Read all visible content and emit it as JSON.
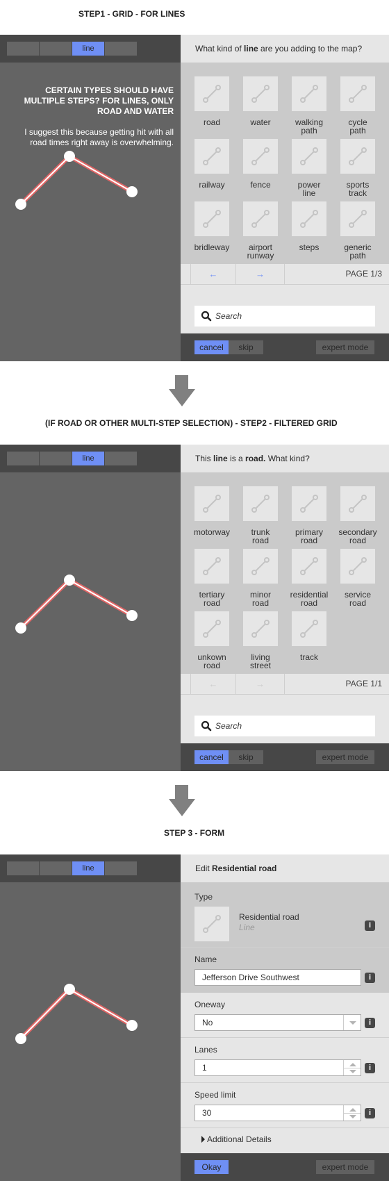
{
  "steps": [
    {
      "title": "STEP1 - GRID - FOR LINES",
      "mode_tabs": [
        "",
        "",
        "line",
        ""
      ],
      "active_mode": "line",
      "note": {
        "title": "CERTAIN TYPES SHOULD HAVE MULTIPLE STEPS? FOR LINES, ONLY ROAD AND WATER",
        "body": "I suggest this because getting hit with all road times right away is overwhelming."
      },
      "header": {
        "pre": "What kind of ",
        "bold": "line",
        "post": " are you adding to the map?"
      },
      "presets": [
        {
          "label": "road"
        },
        {
          "label": "water"
        },
        {
          "label": "walking path"
        },
        {
          "label": "cycle path"
        },
        {
          "label": "railway"
        },
        {
          "label": "fence"
        },
        {
          "label": "power line"
        },
        {
          "label": "sports track"
        },
        {
          "label": "bridleway"
        },
        {
          "label": "airport runway"
        },
        {
          "label": "steps"
        },
        {
          "label": "generic path"
        }
      ],
      "pager": {
        "prev": "←",
        "next": "→",
        "page": "PAGE 1/3",
        "enabled": true
      },
      "search": {
        "placeholder": "Search"
      },
      "footer": {
        "cancel": "cancel",
        "skip": "skip",
        "expert": "expert mode"
      }
    },
    {
      "title": "(IF ROAD OR OTHER MULTI-STEP SELECTION) - STEP2 - FILTERED GRID",
      "mode_tabs": [
        "",
        "",
        "line",
        ""
      ],
      "active_mode": "line",
      "header": {
        "pre1": "This ",
        "bold1": "line",
        "pre2": " is a ",
        "bold2": "road.",
        "post": " What kind?"
      },
      "presets": [
        {
          "label": "motorway"
        },
        {
          "label": "trunk road"
        },
        {
          "label": "primary road"
        },
        {
          "label": "secondary road"
        },
        {
          "label": "tertiary road"
        },
        {
          "label": "minor road"
        },
        {
          "label": "residential road"
        },
        {
          "label": "service road"
        },
        {
          "label": "unkown road"
        },
        {
          "label": "living street"
        },
        {
          "label": "track"
        }
      ],
      "pager": {
        "prev": "←",
        "next": "→",
        "page": "PAGE 1/1",
        "enabled": false
      },
      "search": {
        "placeholder": "Search"
      },
      "footer": {
        "cancel": "cancel",
        "skip": "skip",
        "expert": "expert mode"
      }
    },
    {
      "title": "STEP 3 - FORM",
      "mode_tabs": [
        "",
        "",
        "line",
        ""
      ],
      "active_mode": "line",
      "header": {
        "pre": "Edit ",
        "bold": "Residential road"
      },
      "form": {
        "type": {
          "label": "Type",
          "name": "Residential road",
          "geometry": "Line"
        },
        "name": {
          "label": "Name",
          "value": "Jefferson Drive Southwest"
        },
        "oneway": {
          "label": "Oneway",
          "value": "No"
        },
        "lanes": {
          "label": "Lanes",
          "value": "1"
        },
        "speed": {
          "label": "Speed limit",
          "value": "30"
        },
        "additional": "Additional Details",
        "info_glyph": "i"
      },
      "footer": {
        "okay": "Okay",
        "expert": "expert mode"
      }
    }
  ],
  "colors": {
    "accent": "#6f8ff5",
    "map_bg": "#646464",
    "toolbar_bg": "#474747",
    "line_stroke": "#e06666",
    "panel_bg": "#e6e6e6",
    "grid_bg": "#cacaca"
  }
}
